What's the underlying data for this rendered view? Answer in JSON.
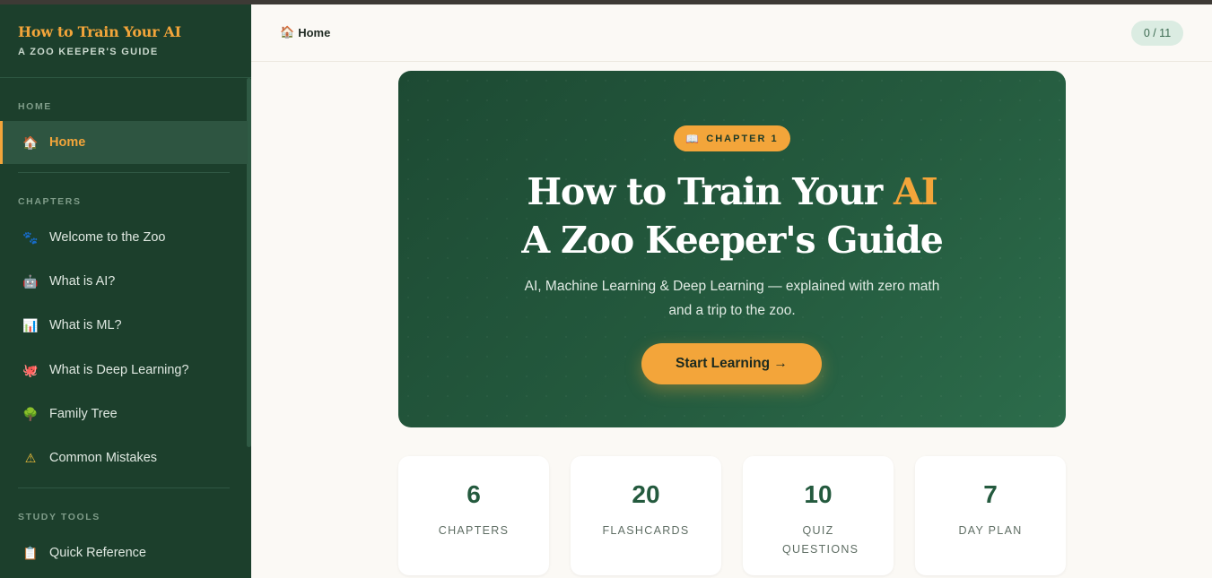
{
  "sidebar": {
    "brand_title": "How to Train Your AI",
    "brand_subtitle": "A ZOO KEEPER'S GUIDE",
    "sections": [
      {
        "label": "HOME",
        "items": [
          {
            "icon": "house-icon",
            "glyph": "🏠",
            "label": "Home",
            "active": true
          }
        ]
      },
      {
        "label": "CHAPTERS",
        "items": [
          {
            "icon": "paw-icon",
            "glyph": "🐾",
            "label": "Welcome to the Zoo"
          },
          {
            "icon": "robot-icon",
            "glyph": "🤖",
            "label": "What is AI?"
          },
          {
            "icon": "bar-chart-icon",
            "glyph": "📊",
            "label": "What is ML?"
          },
          {
            "icon": "octopus-icon",
            "glyph": "🐙",
            "label": "What is Deep Learning?"
          },
          {
            "icon": "tree-icon",
            "glyph": "🌳",
            "label": "Family Tree"
          },
          {
            "icon": "warning-icon",
            "glyph": "⚠",
            "label": "Common Mistakes"
          }
        ]
      },
      {
        "label": "STUDY TOOLS",
        "items": [
          {
            "icon": "clipboard-icon",
            "glyph": "📋",
            "label": "Quick Reference"
          }
        ]
      }
    ]
  },
  "header": {
    "breadcrumb_icon": "house-icon",
    "breadcrumb_glyph": "🏠",
    "breadcrumb": "Home",
    "progress": "0 / 11"
  },
  "hero": {
    "badge_icon": "book-icon",
    "badge_glyph": "📖",
    "badge": "CHAPTER 1",
    "title_line1_prefix": "How to Train Your ",
    "title_line1_accent": "AI",
    "title_line2": "A Zoo Keeper's Guide",
    "desc_line1": "AI, Machine Learning & Deep Learning — explained with zero math",
    "desc_line2": "and a trip to the zoo.",
    "cta": "Start Learning →"
  },
  "stats": [
    {
      "value": "6",
      "label": "CHAPTERS"
    },
    {
      "value": "20",
      "label": "FLASHCARDS"
    },
    {
      "value": "10",
      "label": "QUIZ QUESTIONS"
    },
    {
      "value": "7",
      "label": "DAY PLAN"
    }
  ],
  "colors": {
    "sidebar_bg": "#1c3f2c",
    "accent": "#f3a53a",
    "hero_bg": "#245a3e",
    "page_bg": "#fbf9f5"
  }
}
